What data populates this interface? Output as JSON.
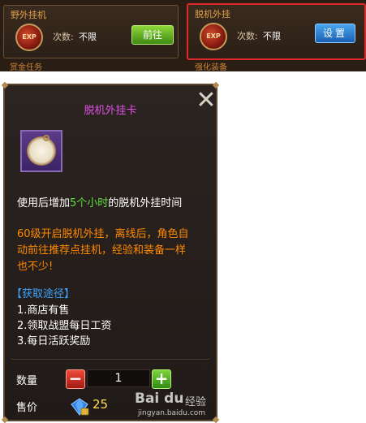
{
  "top": {
    "left_panel": {
      "title": "野外挂机",
      "icon_text": "EXP",
      "count_label": "次数:",
      "count_value": "不限",
      "button_label": "前往"
    },
    "right_panel": {
      "title": "脱机外挂",
      "icon_text": "EXP",
      "count_label": "次数:",
      "count_value": "不限",
      "button_label": "设置"
    },
    "sub_tab_left": "赏金任务",
    "sub_tab_right": "强化装备"
  },
  "card": {
    "title": "脱机外挂卡",
    "desc_pre": "使用后增加",
    "desc_hl": "5个小时",
    "desc_post": "的脱机外挂时间",
    "note_line1": "60级开启脱机外挂，离线后，角色自",
    "note_line2": "动前往推荐点挂机，经验和装备一样",
    "note_line3": "也不少!",
    "source_title": "【获取途径】",
    "source_items": [
      "1.商店有售",
      "2.领取战盟每日工资",
      "3.每日活跃奖励"
    ],
    "qty_label": "数量",
    "qty_value": "1",
    "price_label": "售价",
    "price_value": "25"
  },
  "watermark": {
    "logo": "Bai du",
    "cn": "经验",
    "url": "jingyan.baidu.com"
  },
  "colors": {
    "title": "#e252e6",
    "highlight": "#5ee03b",
    "note": "#ff8a00",
    "source": "#3aa3ff",
    "price": "#ffe14a",
    "selected_border": "#e0282a"
  }
}
